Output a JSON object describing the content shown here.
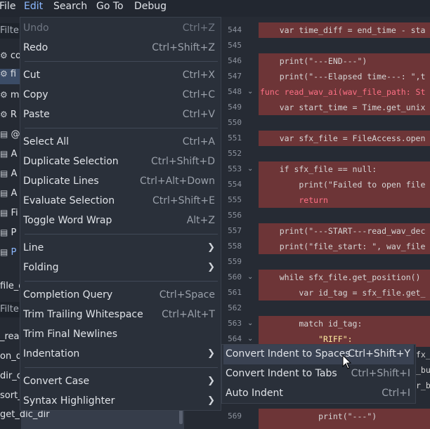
{
  "menubar": {
    "file": "File",
    "edit": "Edit",
    "search": "Search",
    "goto": "Go To",
    "debug": "Debug"
  },
  "left_panel": {
    "filter1": "Filter",
    "rows": [
      "co",
      "fi",
      "m",
      "R",
      "@",
      "A",
      "A",
      "A",
      "Fi",
      "P",
      "P",
      "T"
    ],
    "file_label": "file_d",
    "filter2": "Filter",
    "list": [
      "_read",
      "on_d",
      "dir_c",
      "sort_",
      "get_dic_dir"
    ]
  },
  "edit_menu": {
    "items": [
      {
        "label": "Undo",
        "shortcut": "Ctrl+Z",
        "disabled": true
      },
      {
        "label": "Redo",
        "shortcut": "Ctrl+Shift+Z"
      },
      {
        "label": "Cut",
        "shortcut": "Ctrl+X"
      },
      {
        "label": "Copy",
        "shortcut": "Ctrl+C"
      },
      {
        "label": "Paste",
        "shortcut": "Ctrl+V"
      },
      {
        "label": "Select All",
        "shortcut": "Ctrl+A"
      },
      {
        "label": "Duplicate Selection",
        "shortcut": "Ctrl+Shift+D"
      },
      {
        "label": "Duplicate Lines",
        "shortcut": "Ctrl+Alt+Down"
      },
      {
        "label": "Evaluate Selection",
        "shortcut": "Ctrl+Shift+E"
      },
      {
        "label": "Toggle Word Wrap",
        "shortcut": "Alt+Z"
      },
      {
        "label": "Line",
        "shortcut": ""
      },
      {
        "label": "Folding",
        "shortcut": ""
      },
      {
        "label": "Completion Query",
        "shortcut": "Ctrl+Space"
      },
      {
        "label": "Trim Trailing Whitespace",
        "shortcut": "Ctrl+Alt+T"
      },
      {
        "label": "Trim Final Newlines",
        "shortcut": ""
      },
      {
        "label": "Indentation",
        "shortcut": ""
      },
      {
        "label": "Convert Case",
        "shortcut": ""
      },
      {
        "label": "Syntax Highlighter",
        "shortcut": ""
      }
    ]
  },
  "indent_submenu": {
    "items": [
      {
        "label": "Convert Indent to Spaces",
        "shortcut": "Ctrl+Shift+Y"
      },
      {
        "label": "Convert Indent to Tabs",
        "shortcut": "Ctrl+Shift+I"
      },
      {
        "label": "Auto Indent",
        "shortcut": "Ctrl+I"
      }
    ]
  },
  "editor": {
    "line_numbers": [
      "544",
      "545",
      "546",
      "547",
      "548",
      "549",
      "550",
      "551",
      "552",
      "553",
      "554",
      "555",
      "556",
      "557",
      "558",
      "559",
      "560",
      "561",
      "562",
      "563",
      "564",
      "565",
      "566",
      "567",
      "568",
      "569"
    ],
    "code": {
      "l544": "    var time_diff = end_time - sta",
      "l546": "    print(\"---END---\")",
      "l547": "    print(\"---Elapsed time---: \",t",
      "l548": "func read_wav_ai(wav_file_path: St",
      "l549": "    var start_time = Time.get_unix",
      "l551": "    var sfx_file = FileAccess.open",
      "l553": "    if sfx_file == null:",
      "l554": "        print(\"Failed to open file",
      "l555": "        return",
      "l557": "    print(\"---START---read_wav_dec",
      "l558": "    print(\"file_start: \", wav_file",
      "l560": "    while sfx_file.get_position()",
      "l561": "        var id_tag = sfx_file.get_",
      "l563": "        match id_tag:",
      "l564": "            \"RIFF\":",
      "l566": "fx_f",
      "l567": "_buf",
      "l568": "r_b",
      "l569": "            print(\"---\")"
    }
  }
}
